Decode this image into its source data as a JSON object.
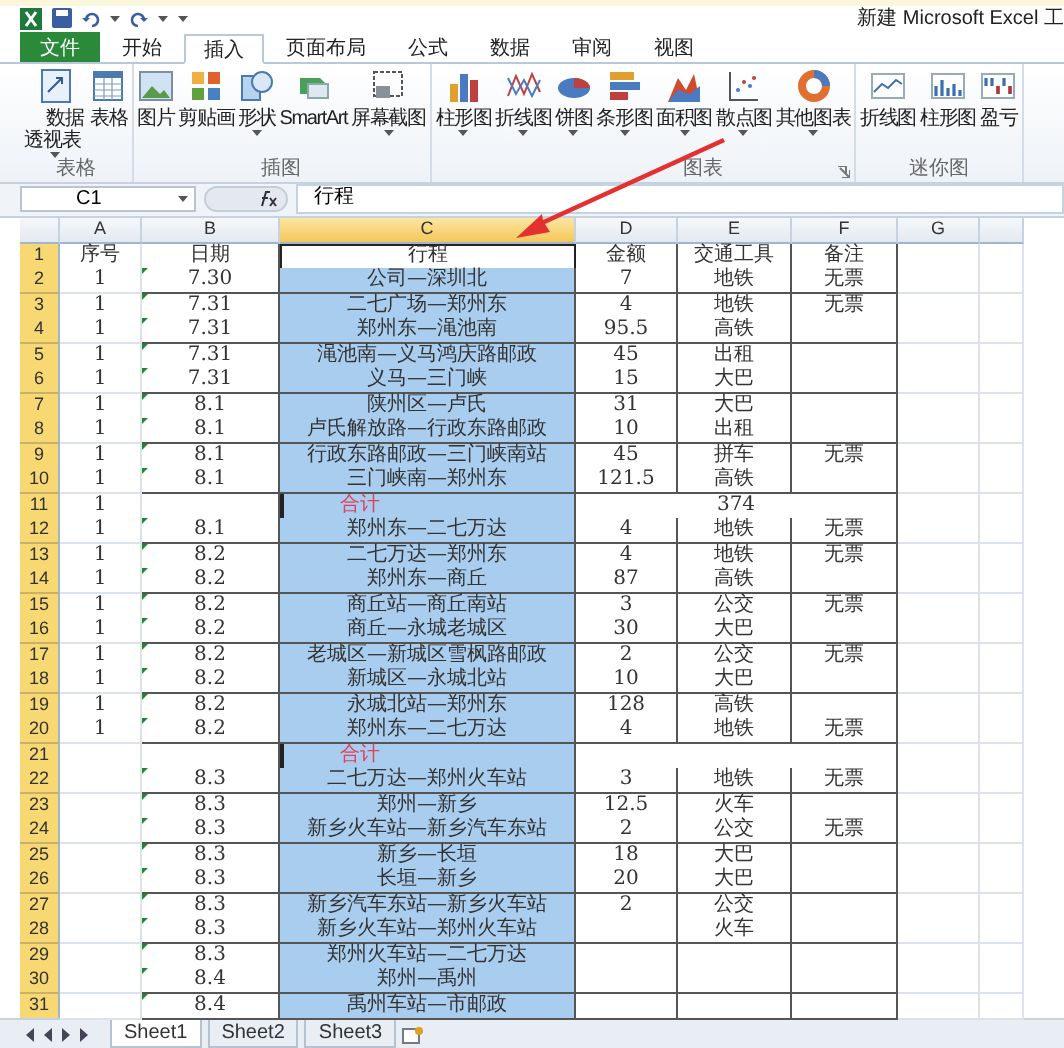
{
  "title_bar": {
    "title": "新建 Microsoft Excel 工"
  },
  "ribbon": {
    "tabs": [
      {
        "label": "文件",
        "kind": "file",
        "selected": false
      },
      {
        "label": "开始",
        "kind": "tab",
        "selected": false
      },
      {
        "label": "插入",
        "kind": "tab",
        "selected": true
      },
      {
        "label": "页面布局",
        "kind": "tab",
        "selected": false
      },
      {
        "label": "公式",
        "kind": "tab",
        "selected": false
      },
      {
        "label": "数据",
        "kind": "tab",
        "selected": false
      },
      {
        "label": "审阅",
        "kind": "tab",
        "selected": false
      },
      {
        "label": "视图",
        "kind": "tab",
        "selected": false
      }
    ],
    "groups": [
      {
        "label": "表格",
        "launcher": false,
        "buttons": [
          {
            "label": "数据透视表",
            "dropdown": true,
            "wrapped": true
          },
          {
            "label": "表格",
            "dropdown": false
          }
        ]
      },
      {
        "label": "插图",
        "launcher": false,
        "buttons": [
          {
            "label": "图片",
            "dropdown": false
          },
          {
            "label": "剪贴画",
            "dropdown": false
          },
          {
            "label": "形状",
            "dropdown": true
          },
          {
            "label": "SmartArt",
            "dropdown": false
          },
          {
            "label": "屏幕截图",
            "dropdown": true
          }
        ]
      },
      {
        "label": "图表",
        "launcher": true,
        "buttons": [
          {
            "label": "柱形图",
            "dropdown": true
          },
          {
            "label": "折线图",
            "dropdown": true
          },
          {
            "label": "饼图",
            "dropdown": true
          },
          {
            "label": "条形图",
            "dropdown": true
          },
          {
            "label": "面积图",
            "dropdown": true
          },
          {
            "label": "散点图",
            "dropdown": true
          },
          {
            "label": "其他图表",
            "dropdown": true
          }
        ]
      },
      {
        "label": "迷你图",
        "launcher": false,
        "buttons": [
          {
            "label": "折线图",
            "dropdown": false
          },
          {
            "label": "柱形图",
            "dropdown": false
          },
          {
            "label": "盈亏",
            "dropdown": false
          }
        ]
      }
    ]
  },
  "formula_bar": {
    "name_box": "C1",
    "formula": "行程"
  },
  "sheet": {
    "columns": [
      {
        "label": "A",
        "selected": false
      },
      {
        "label": "B",
        "selected": false
      },
      {
        "label": "C",
        "selected": true
      },
      {
        "label": "D",
        "selected": false
      },
      {
        "label": "E",
        "selected": false
      },
      {
        "label": "F",
        "selected": false
      },
      {
        "label": "G",
        "selected": false
      }
    ],
    "rows": [
      {
        "number": "1",
        "selected": true,
        "active": true,
        "kind": "row",
        "A": "序号",
        "B": "日期",
        "C": "行程",
        "D": "金额",
        "E": "交通工具",
        "F": "备注"
      },
      {
        "number": "2",
        "selected": true,
        "active": false,
        "kind": "row",
        "A": "1",
        "B": "7.30",
        "C": "公司—深圳北",
        "D": "7",
        "E": "地铁",
        "F": "无票"
      },
      {
        "number": "3",
        "selected": true,
        "active": false,
        "kind": "row",
        "A": "1",
        "B": "7.31",
        "C": "二七广场—郑州东",
        "D": "4",
        "E": "地铁",
        "F": "无票"
      },
      {
        "number": "4",
        "selected": true,
        "active": false,
        "kind": "row",
        "A": "1",
        "B": "7.31",
        "C": "郑州东—渑池南",
        "D": "95.5",
        "E": "高铁"
      },
      {
        "number": "5",
        "selected": true,
        "active": false,
        "kind": "row",
        "A": "1",
        "B": "7.31",
        "C": "渑池南—义马鸿庆路邮政",
        "D": "45",
        "E": "出租"
      },
      {
        "number": "6",
        "selected": true,
        "active": false,
        "kind": "row",
        "A": "1",
        "B": "7.31",
        "C": "义马—三门峡",
        "D": "15",
        "E": "大巴"
      },
      {
        "number": "7",
        "selected": true,
        "active": false,
        "kind": "row",
        "A": "1",
        "B": "8.1",
        "C": "陕州区—卢氏",
        "D": "31",
        "E": "大巴"
      },
      {
        "number": "8",
        "selected": true,
        "active": false,
        "kind": "row",
        "A": "1",
        "B": "8.1",
        "C": "卢氏解放路—行政东路邮政",
        "D": "10",
        "E": "出租"
      },
      {
        "number": "9",
        "selected": true,
        "active": false,
        "kind": "row",
        "A": "1",
        "B": "8.1",
        "C": "行政东路邮政—三门峡南站",
        "D": "45",
        "E": "拼车",
        "F": "无票"
      },
      {
        "number": "10",
        "selected": true,
        "active": false,
        "kind": "row",
        "A": "1",
        "B": "8.1",
        "C": "三门峡南—郑州东",
        "D": "121.5",
        "E": "高铁"
      },
      {
        "number": "11",
        "selected": true,
        "active": false,
        "kind": "subtotal",
        "A": "1",
        "C": "合计",
        "total": "374"
      },
      {
        "number": "12",
        "selected": true,
        "active": false,
        "kind": "row",
        "A": "1",
        "B": "8.1",
        "C": "郑州东—二七万达",
        "D": "4",
        "E": "地铁",
        "F": "无票"
      },
      {
        "number": "13",
        "selected": true,
        "active": false,
        "kind": "row",
        "A": "1",
        "B": "8.2",
        "C": "二七万达—郑州东",
        "D": "4",
        "E": "地铁",
        "F": "无票"
      },
      {
        "number": "14",
        "selected": true,
        "active": false,
        "kind": "row",
        "A": "1",
        "B": "8.2",
        "C": "郑州东—商丘",
        "D": "87",
        "E": "高铁"
      },
      {
        "number": "15",
        "selected": true,
        "active": false,
        "kind": "row",
        "A": "1",
        "B": "8.2",
        "C": "商丘站—商丘南站",
        "D": "3",
        "E": "公交",
        "F": "无票"
      },
      {
        "number": "16",
        "selected": true,
        "active": false,
        "kind": "row",
        "A": "1",
        "B": "8.2",
        "C": "商丘—永城老城区",
        "D": "30",
        "E": "大巴"
      },
      {
        "number": "17",
        "selected": true,
        "active": false,
        "kind": "row",
        "A": "1",
        "B": "8.2",
        "C": "老城区—新城区雪枫路邮政",
        "D": "2",
        "E": "公交",
        "F": "无票"
      },
      {
        "number": "18",
        "selected": true,
        "active": false,
        "kind": "row",
        "A": "1",
        "B": "8.2",
        "C": "新城区—永城北站",
        "D": "10",
        "E": "大巴"
      },
      {
        "number": "19",
        "selected": true,
        "active": false,
        "kind": "row",
        "A": "1",
        "B": "8.2",
        "C": "永城北站—郑州东",
        "D": "128",
        "E": "高铁"
      },
      {
        "number": "20",
        "selected": true,
        "active": false,
        "kind": "row",
        "A": "1",
        "B": "8.2",
        "C": "郑州东—二七万达",
        "D": "4",
        "E": "地铁",
        "F": "无票"
      },
      {
        "number": "21",
        "selected": true,
        "active": false,
        "kind": "subtotal",
        "C": "合计"
      },
      {
        "number": "22",
        "selected": true,
        "active": false,
        "kind": "row",
        "B": "8.3",
        "C": "二七万达—郑州火车站",
        "D": "3",
        "E": "地铁",
        "F": "无票"
      },
      {
        "number": "23",
        "selected": true,
        "active": false,
        "kind": "row",
        "B": "8.3",
        "C": "郑州—新乡",
        "D": "12.5",
        "E": "火车"
      },
      {
        "number": "24",
        "selected": true,
        "active": false,
        "kind": "row",
        "B": "8.3",
        "C": "新乡火车站—新乡汽车东站",
        "D": "2",
        "E": "公交",
        "F": "无票"
      },
      {
        "number": "25",
        "selected": true,
        "active": false,
        "kind": "row",
        "B": "8.3",
        "C": "新乡—长垣",
        "D": "18",
        "E": "大巴"
      },
      {
        "number": "26",
        "selected": true,
        "active": false,
        "kind": "row",
        "B": "8.3",
        "C": "长垣—新乡",
        "D": "20",
        "E": "大巴"
      },
      {
        "number": "27",
        "selected": true,
        "active": false,
        "kind": "row",
        "B": "8.3",
        "C": "新乡汽车东站—新乡火车站",
        "D": "2",
        "E": "公交"
      },
      {
        "number": "28",
        "selected": true,
        "active": false,
        "kind": "row",
        "B": "8.3",
        "C": "新乡火车站—郑州火车站",
        "E": "火车"
      },
      {
        "number": "29",
        "selected": true,
        "active": false,
        "kind": "row",
        "B": "8.3",
        "C": "郑州火车站—二七万达"
      },
      {
        "number": "30",
        "selected": true,
        "active": false,
        "kind": "row",
        "B": "8.4",
        "C": "郑州—禹州"
      },
      {
        "number": "31",
        "selected": true,
        "active": false,
        "kind": "row",
        "B": "8.4",
        "C": "禹州车站—市邮政"
      }
    ]
  },
  "sheet_tabs": [
    {
      "label": "Sheet1",
      "selected": true
    },
    {
      "label": "Sheet2",
      "selected": false
    },
    {
      "label": "Sheet3",
      "selected": false
    }
  ]
}
